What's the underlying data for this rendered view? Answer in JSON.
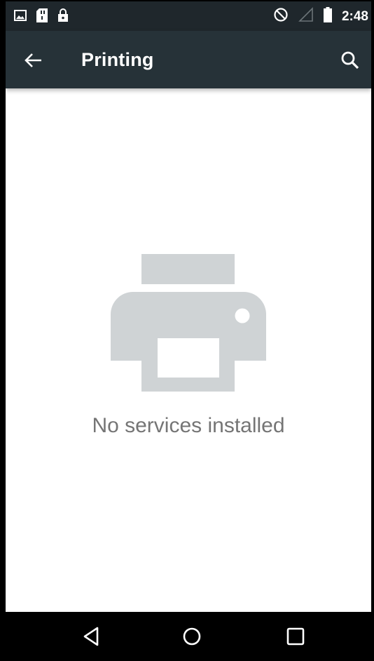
{
  "status_bar": {
    "time": "2:48",
    "left_icons": [
      "image-icon",
      "sd-card-icon",
      "lock-icon"
    ],
    "right_icons": [
      "do-not-disturb-icon",
      "signal-icon",
      "battery-icon"
    ]
  },
  "app_bar": {
    "title": "Printing",
    "back_icon": "arrow-back-icon",
    "search_icon": "search-icon",
    "background_color": "#263238"
  },
  "empty_state": {
    "icon": "printer-icon",
    "message": "No services installed",
    "icon_color": "#cfd3d5",
    "text_color": "#757575"
  },
  "nav_bar": {
    "buttons": [
      "back-triangle-icon",
      "home-circle-icon",
      "recents-square-icon"
    ]
  }
}
